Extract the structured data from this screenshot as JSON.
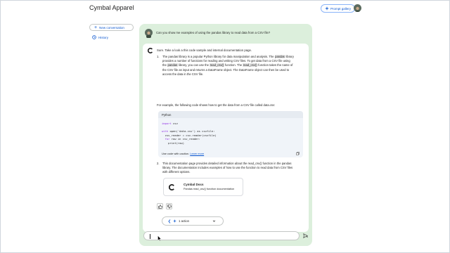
{
  "app": {
    "title": "Cymbal Apparel",
    "prompt_gallery_label": "Prompt gallery"
  },
  "sidebar": {
    "new_conversation_label": "New conversation",
    "history_label": "History"
  },
  "conversation": {
    "user_question": "Can you show me examples of using the pandas library to read data from a CSV file?",
    "response_intro": "Sure. Take a look a this code sample and internal documentation page.",
    "item1": {
      "number": "1.",
      "t1": "The pandas library is a popular Python library for data manipulation and analysis. The ",
      "h1": "pandas",
      "t2": " library provides a number of functions for reading and writing CSV files. To get data from a CSV file using the ",
      "h2": "pandas",
      "t3": " library, you can use the ",
      "h3": "read_csv()",
      "t4": " function. The ",
      "h4": "read_csv()",
      "t5": " function takes the name of the CSV file as input and returns a DataFrame object. The DataFrame object can then be used to access the data in the CSV file."
    },
    "example_intro": "For example, the following code shows how to get the data from a CSV file called data.csv:",
    "code": {
      "language": "Python",
      "line1_kw": "import",
      "line1_rest": " csv",
      "line2_kw": "with",
      "line2_rest": " open('data.csv') as csvfile:",
      "line3": "  csv_reader = csv.reader(csvfile)",
      "line4_kw": "  for",
      "line4_rest": " row in csv_reader:",
      "line5": "    print(row)",
      "caution": "Use code with caution. ",
      "learn_more": "Learn more"
    },
    "item2": {
      "number": "2.",
      "text": "This documentation page provides detailed information about the read_csv() function in the pandas library. The documentation includes examples of how to use the function to read data from CSV files with different options."
    },
    "doc_card": {
      "title": "Cymbal Docs",
      "subtitle": "Pandas read_csv() function documentation"
    },
    "action_label": "1 action"
  },
  "input": {
    "placeholder": ""
  },
  "colors": {
    "panel_bg": "#dcefdc",
    "accent": "#0b57d0",
    "highlight": "#e3e3e3"
  }
}
